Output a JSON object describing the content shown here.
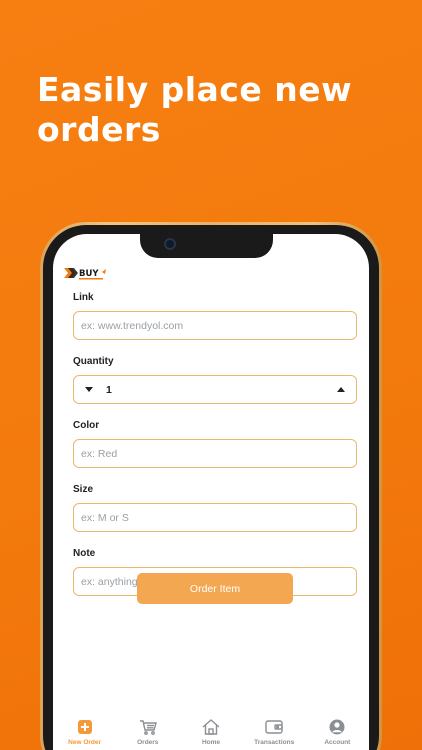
{
  "headline": {
    "text": "Easily place new orders"
  },
  "app": {
    "logo": {
      "text": "BUY"
    },
    "form": {
      "link": {
        "label": "Link",
        "placeholder": "ex: www.trendyol.com",
        "value": ""
      },
      "quantity": {
        "label": "Quantity",
        "value": "1"
      },
      "color": {
        "label": "Color",
        "placeholder": "ex: Red",
        "value": ""
      },
      "size": {
        "label": "Size",
        "placeholder": "ex: M or S",
        "value": ""
      },
      "note": {
        "label": "Note",
        "placeholder": "ex: anything you want to write",
        "value": ""
      }
    },
    "order_button": {
      "label": "Order Item"
    },
    "nav": [
      {
        "label": "New Order",
        "icon": "plus-square-icon",
        "active": true
      },
      {
        "label": "Orders",
        "icon": "cart-icon",
        "active": false
      },
      {
        "label": "Home",
        "icon": "home-icon",
        "active": false
      },
      {
        "label": "Transactions",
        "icon": "wallet-icon",
        "active": false
      },
      {
        "label": "Account",
        "icon": "user-icon",
        "active": false
      }
    ]
  },
  "colors": {
    "background": "#f37a0d",
    "accent": "#f29a3a",
    "button": "#f4a751",
    "input_border": "#e8b96f",
    "inactive_nav": "#8b8f94"
  }
}
